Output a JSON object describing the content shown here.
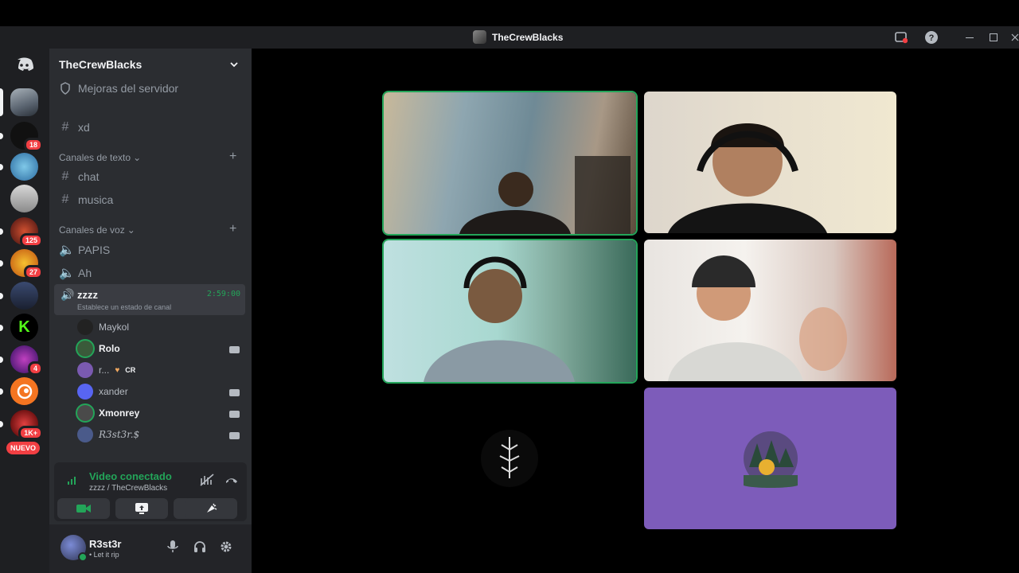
{
  "window": {
    "title": "TheCrewBlacks"
  },
  "server": {
    "name": "TheCrewBlacks"
  },
  "server_rail": {
    "badges": [
      "18",
      "125",
      "27",
      "4",
      "1K+"
    ],
    "new_label": "NUEVO"
  },
  "channels": {
    "boost": "Mejoras del servidor",
    "top_channel": "xd",
    "text_category": "Canales de texto",
    "text_channels": [
      "chat",
      "musica"
    ],
    "voice_category": "Canales de voz",
    "voice_channels": [
      "PAPIS",
      "Ah"
    ],
    "active_voice": {
      "name": "zzzz",
      "time": "2:59:00",
      "status": "Establece un estado de canal"
    },
    "voice_users": [
      "Maykol",
      "Rolo",
      "r...",
      "xander",
      "Xmonrey",
      "R3st3r.$"
    ],
    "cr_tag": "CR"
  },
  "voice_panel": {
    "title": "Video conectado",
    "subtitle": "zzzz / TheCrewBlacks"
  },
  "user": {
    "name": "R3st3r",
    "status": "• Let it rip"
  },
  "colors": {
    "accent_green": "#23a559",
    "blurple": "#5865f2",
    "tile_purple": "#7d5cba",
    "danger": "#f23f43"
  },
  "icons": [
    "discord-logo-icon",
    "chevron-down-icon",
    "hash-icon",
    "speaker-icon",
    "plus-icon",
    "camera-icon",
    "screen-share-icon",
    "activities-icon",
    "soundboard-icon",
    "mic-icon",
    "headphones-icon",
    "gear-icon",
    "disconnect-icon",
    "noise-suppression-icon",
    "signal-icon",
    "help-icon",
    "minimize-icon",
    "maximize-icon",
    "close-icon"
  ]
}
